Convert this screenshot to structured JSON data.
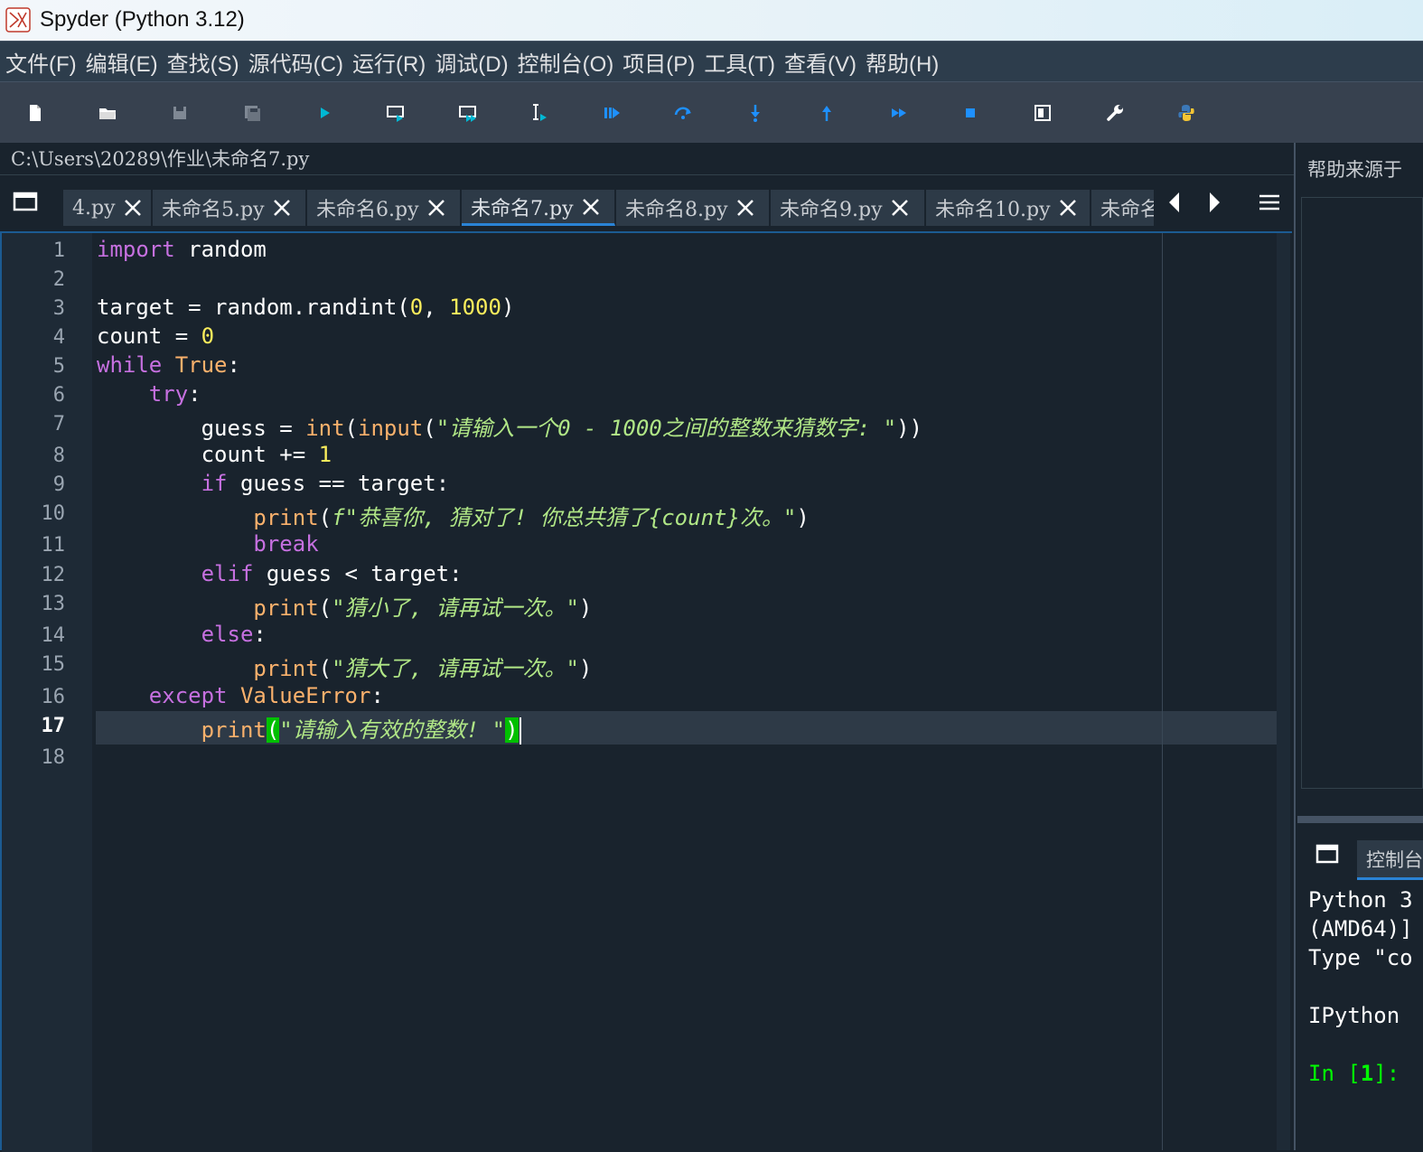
{
  "window": {
    "title": "Spyder (Python 3.12)"
  },
  "menu": [
    "文件(F)",
    "编辑(E)",
    "查找(S)",
    "源代码(C)",
    "运行(R)",
    "调试(D)",
    "控制台(O)",
    "项目(P)",
    "工具(T)",
    "查看(V)",
    "帮助(H)"
  ],
  "toolbar": {
    "buttons": [
      "new-file",
      "open-file",
      "save",
      "save-all",
      "run",
      "run-cell",
      "run-cell-advance",
      "run-selection",
      "debug",
      "step-over",
      "step-into",
      "step-return",
      "continue",
      "stop",
      "maximize-pane",
      "preferences",
      "python-path"
    ]
  },
  "editor": {
    "path": "C:\\Users\\20289\\作业\\未命名7.py",
    "tabs": [
      "4.py",
      "未命名5.py",
      "未命名6.py",
      "未命名7.py",
      "未命名8.py",
      "未命名9.py",
      "未命名10.py",
      "未命名"
    ],
    "active_tab": "未命名7.py",
    "current_line": 17,
    "line_numbers": [
      "1",
      "2",
      "3",
      "4",
      "5",
      "6",
      "7",
      "8",
      "9",
      "10",
      "11",
      "12",
      "13",
      "14",
      "15",
      "16",
      "17",
      "18"
    ],
    "code": [
      "import random",
      "",
      "target = random.randint(0, 1000)",
      "count = 0",
      "while True:",
      "    try:",
      "        guess = int(input(\"请输入一个0 - 1000之间的整数来猜数字: \"))",
      "        count += 1",
      "        if guess == target:",
      "            print(f\"恭喜你, 猜对了! 你总共猜了{count}次。\")",
      "            break",
      "        elif guess < target:",
      "            print(\"猜小了, 请再试一次。\")",
      "        else:",
      "            print(\"猜大了, 请再试一次。\")",
      "    except ValueError:",
      "        print(\"请输入有效的整数! \")",
      ""
    ]
  },
  "help_pane": {
    "title": "帮助来源于"
  },
  "console": {
    "tab_label": "控制台",
    "lines": [
      "Python 3",
      "(AMD64)]",
      "Type \"co",
      "",
      "IPython"
    ],
    "prompt": "In [1]:"
  },
  "colors": {
    "keyword": "#c670e0",
    "builtin": "#fab16c",
    "number": "#faed5c",
    "string": "#b0e686",
    "background": "#19232d",
    "accent": "#2a83d6"
  }
}
